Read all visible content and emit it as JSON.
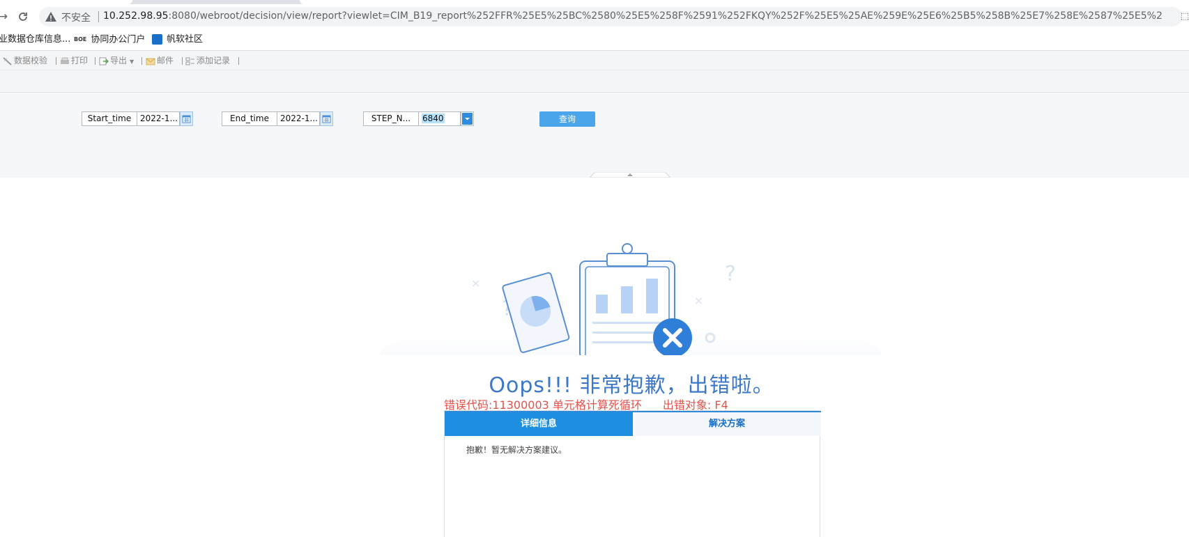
{
  "browser": {
    "security_label": "不安全",
    "url_host": "10.252.98.95",
    "url_rest": ":8080/webroot/decision/view/report?viewlet=CIM_B19_report%252FFR%25E5%25BC%2580%25E5%258F%2591%252FKQY%252F%25E5%25AE%259E%25E6%25B5%258B%25E7%258E%2587%25E5%258F%25AF%25E..."
  },
  "bookmarks": [
    {
      "label": "业数据仓库信息...",
      "icon": "page-icon"
    },
    {
      "label": "协同办公门户",
      "icon": "boe-icon"
    },
    {
      "label": "帆软社区",
      "icon": "fanruan-icon"
    }
  ],
  "report_toolbar": {
    "validate": "数据校验",
    "print": "打印",
    "export": "导出",
    "email": "邮件",
    "add_record": "添加记录"
  },
  "params": {
    "start_label": "Start_time",
    "start_value": "2022-1...",
    "end_label": "End_time",
    "end_value": "2022-1...",
    "step_label": "STEP_N...",
    "step_value": "6840",
    "query_button": "查询"
  },
  "error": {
    "title": "Oops!!! 非常抱歉，出错啦。",
    "code_text": "错误代码:11300003 单元格计算死循环",
    "object_text": "出错对象:   F4",
    "tabs": [
      "详细信息",
      "解决方案"
    ],
    "active_tab": "详细信息",
    "body_text": "抱歉！暂无解决方案建议。"
  },
  "colors": {
    "accent": "#1e8ee0",
    "error_red": "#e0524b",
    "title_blue": "#3c78c8",
    "query_button": "#4ba5ea"
  }
}
